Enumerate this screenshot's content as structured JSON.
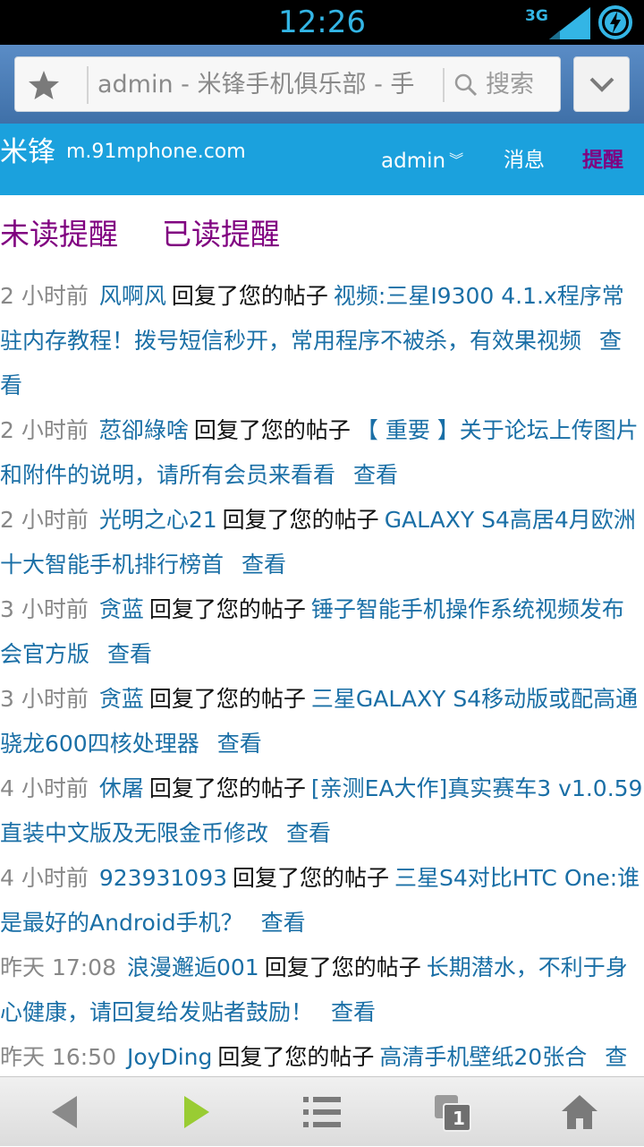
{
  "statusbar": {
    "time": "12:26",
    "network": "3G"
  },
  "browser": {
    "url_text": "admin - 米锋手机俱乐部 - 手",
    "search_label": "搜索"
  },
  "site": {
    "name": "米锋",
    "url": "m.91mphone.com",
    "nav": {
      "user": "admin",
      "messages": "消息",
      "reminders": "提醒"
    }
  },
  "tabs": {
    "unread": "未读提醒",
    "read": "已读提醒"
  },
  "notifications": [
    {
      "time": "2 小时前",
      "user": "风啊风",
      "action": "回复了您的帖子",
      "title": "视频:三星I9300 4.1.x程序常驻内存教程！拨号短信秒开，常用程序不被杀，有效果视频",
      "view": "查看"
    },
    {
      "time": "2 小时前",
      "user": "荵卻綠啥",
      "action": "回复了您的帖子",
      "title": "【 重要 】关于论坛上传图片和附件的说明，请所有会员来看看",
      "view": "查看"
    },
    {
      "time": "2 小时前",
      "user": "光明之心21",
      "action": "回复了您的帖子",
      "title": "GALAXY S4高居4月欧洲十大智能手机排行榜首",
      "view": "查看"
    },
    {
      "time": "3 小时前",
      "user": "贪蓝",
      "action": "回复了您的帖子",
      "title": "锤子智能手机操作系统视频发布会官方版",
      "view": "查看"
    },
    {
      "time": "3 小时前",
      "user": "贪蓝",
      "action": "回复了您的帖子",
      "title": "三星GALAXY S4移动版或配高通骁龙600四核处理器",
      "view": "查看"
    },
    {
      "time": "4 小时前",
      "user": "休屠",
      "action": "回复了您的帖子",
      "title": "[亲测EA大作]真实赛车3 v1.0.59 直装中文版及无限金币修改",
      "view": "查看"
    },
    {
      "time": "4 小时前",
      "user": "923931093",
      "action": "回复了您的帖子",
      "title": "三星S4对比HTC One:谁是最好的Android手机？",
      "view": "查看"
    },
    {
      "time": "昨天 17:08",
      "user": "浪漫邂逅001",
      "action": "回复了您的帖子",
      "title": "长期潜水，不利于身心健康，请回复给发贴者鼓励！",
      "view": "查看"
    },
    {
      "time": "昨天 16:50",
      "user": "JoyDing",
      "action": "回复了您的帖子",
      "title": "高清手机壁纸20张合",
      "view": "查看"
    }
  ],
  "bottombar": {
    "tab_count": "1"
  },
  "colors": {
    "link": "#1a6fa6",
    "visited": "#800080",
    "header": "#1ba1dd",
    "status_accent": "#33b5e5"
  }
}
